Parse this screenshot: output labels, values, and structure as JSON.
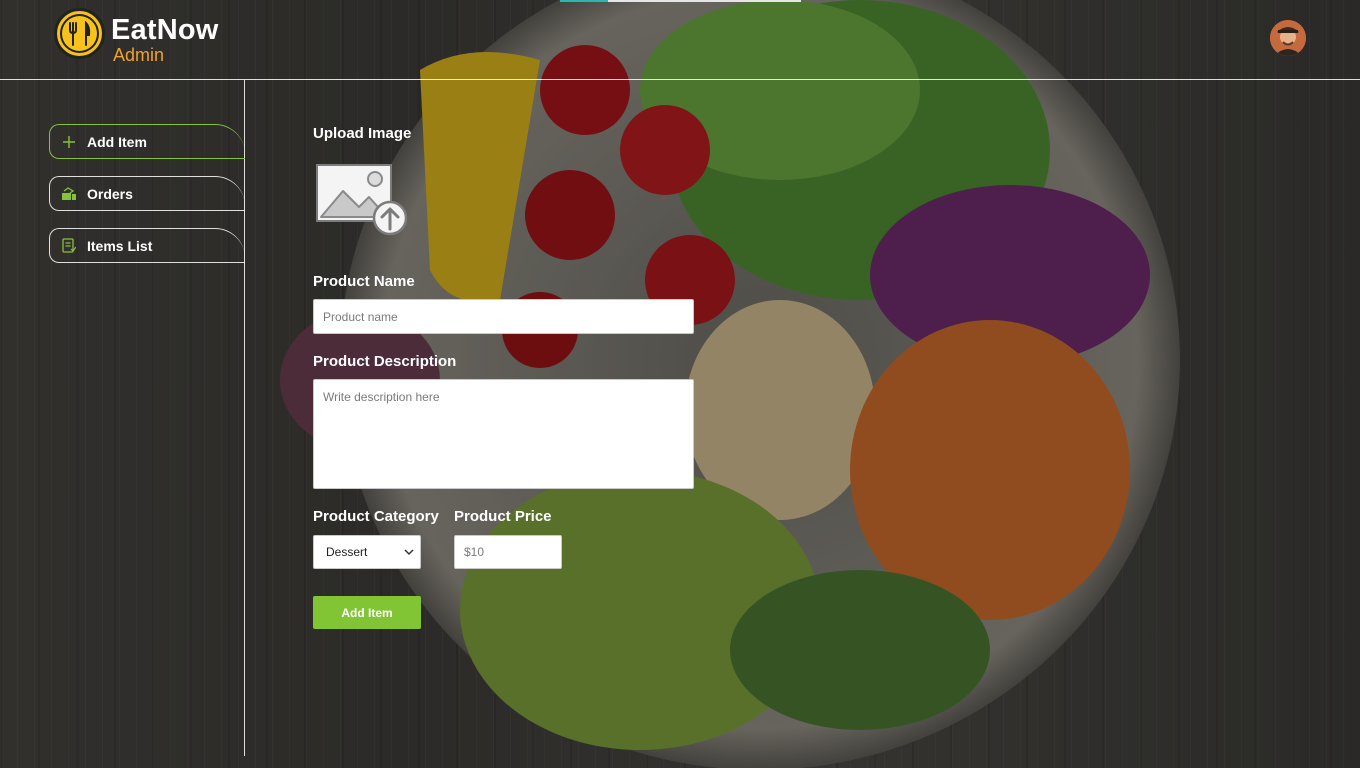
{
  "brand": {
    "name": "EatNow",
    "sub": "Admin"
  },
  "colors": {
    "accent": "#86c23b",
    "brand_orange": "#f0a22a",
    "logo_yellow": "#f6c21b"
  },
  "header": {
    "avatar_icon": "user-avatar"
  },
  "sidebar": {
    "items": [
      {
        "label": "Add Item",
        "icon": "plus-icon",
        "active": true
      },
      {
        "label": "Orders",
        "icon": "orders-icon",
        "active": false
      },
      {
        "label": "Items List",
        "icon": "list-icon",
        "active": false
      }
    ]
  },
  "form": {
    "upload_label": "Upload Image",
    "upload_icon": "image-upload-icon",
    "name_label": "Product Name",
    "name_placeholder": "Product name",
    "description_label": "Product Description",
    "description_placeholder": "Write description here",
    "category_label": "Product Category",
    "category_value": "Dessert",
    "price_label": "Product Price",
    "price_placeholder": "$10",
    "submit_label": "Add Item"
  }
}
